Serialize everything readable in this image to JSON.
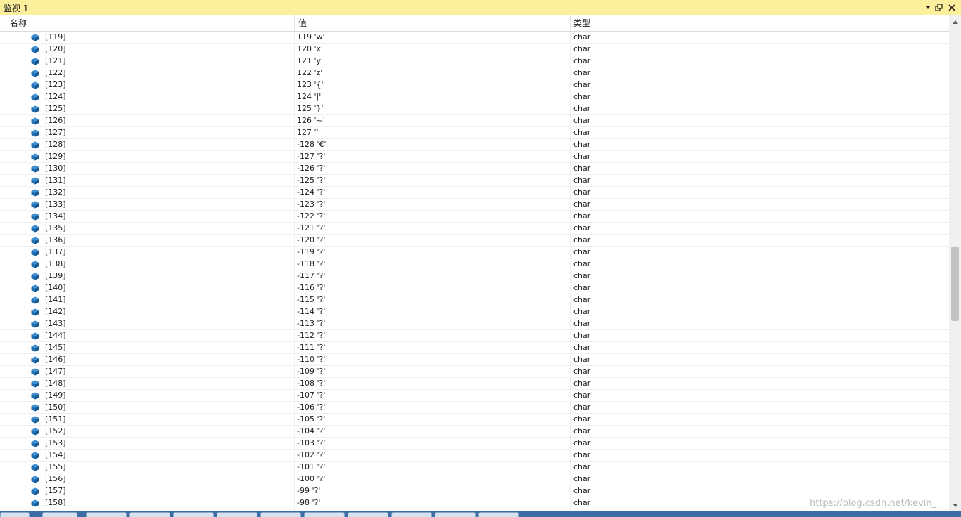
{
  "window": {
    "title": "监视 1"
  },
  "titlebar_buttons": [
    {
      "name": "dropdown-arrow-icon"
    },
    {
      "name": "restore-window-icon"
    },
    {
      "name": "close-icon"
    }
  ],
  "columns": {
    "name": "名称",
    "value": "值",
    "type": "类型"
  },
  "rows": [
    {
      "name": "[119]",
      "value": "119 'w'",
      "type": "char"
    },
    {
      "name": "[120]",
      "value": "120 'x'",
      "type": "char"
    },
    {
      "name": "[121]",
      "value": "121 'y'",
      "type": "char"
    },
    {
      "name": "[122]",
      "value": "122 'z'",
      "type": "char"
    },
    {
      "name": "[123]",
      "value": "123 '{'",
      "type": "char"
    },
    {
      "name": "[124]",
      "value": "124 '|'",
      "type": "char"
    },
    {
      "name": "[125]",
      "value": "125 '}'",
      "type": "char"
    },
    {
      "name": "[126]",
      "value": "126 '~'",
      "type": "char"
    },
    {
      "name": "[127]",
      "value": "127 ''",
      "type": "char"
    },
    {
      "name": "[128]",
      "value": "-128 '€'",
      "type": "char"
    },
    {
      "name": "[129]",
      "value": "-127 '?'",
      "type": "char"
    },
    {
      "name": "[130]",
      "value": "-126 '?'",
      "type": "char"
    },
    {
      "name": "[131]",
      "value": "-125 '?'",
      "type": "char"
    },
    {
      "name": "[132]",
      "value": "-124 '?'",
      "type": "char"
    },
    {
      "name": "[133]",
      "value": "-123 '?'",
      "type": "char"
    },
    {
      "name": "[134]",
      "value": "-122 '?'",
      "type": "char"
    },
    {
      "name": "[135]",
      "value": "-121 '?'",
      "type": "char"
    },
    {
      "name": "[136]",
      "value": "-120 '?'",
      "type": "char"
    },
    {
      "name": "[137]",
      "value": "-119 '?'",
      "type": "char"
    },
    {
      "name": "[138]",
      "value": "-118 '?'",
      "type": "char"
    },
    {
      "name": "[139]",
      "value": "-117 '?'",
      "type": "char"
    },
    {
      "name": "[140]",
      "value": "-116 '?'",
      "type": "char"
    },
    {
      "name": "[141]",
      "value": "-115 '?'",
      "type": "char"
    },
    {
      "name": "[142]",
      "value": "-114 '?'",
      "type": "char"
    },
    {
      "name": "[143]",
      "value": "-113 '?'",
      "type": "char"
    },
    {
      "name": "[144]",
      "value": "-112 '?'",
      "type": "char"
    },
    {
      "name": "[145]",
      "value": "-111 '?'",
      "type": "char"
    },
    {
      "name": "[146]",
      "value": "-110 '?'",
      "type": "char"
    },
    {
      "name": "[147]",
      "value": "-109 '?'",
      "type": "char"
    },
    {
      "name": "[148]",
      "value": "-108 '?'",
      "type": "char"
    },
    {
      "name": "[149]",
      "value": "-107 '?'",
      "type": "char"
    },
    {
      "name": "[150]",
      "value": "-106 '?'",
      "type": "char"
    },
    {
      "name": "[151]",
      "value": "-105 '?'",
      "type": "char"
    },
    {
      "name": "[152]",
      "value": "-104 '?'",
      "type": "char"
    },
    {
      "name": "[153]",
      "value": "-103 '?'",
      "type": "char"
    },
    {
      "name": "[154]",
      "value": "-102 '?'",
      "type": "char"
    },
    {
      "name": "[155]",
      "value": "-101 '?'",
      "type": "char"
    },
    {
      "name": "[156]",
      "value": "-100 '?'",
      "type": "char"
    },
    {
      "name": "[157]",
      "value": "-99 '?'",
      "type": "char"
    },
    {
      "name": "[158]",
      "value": "-98 '?'",
      "type": "char"
    }
  ],
  "watermark": "https://blog.csdn.net/kevin_",
  "colors": {
    "titlebar": "#fdf09d",
    "member_icon": "#1f6fb2"
  },
  "row_icon": "class-member-icon"
}
